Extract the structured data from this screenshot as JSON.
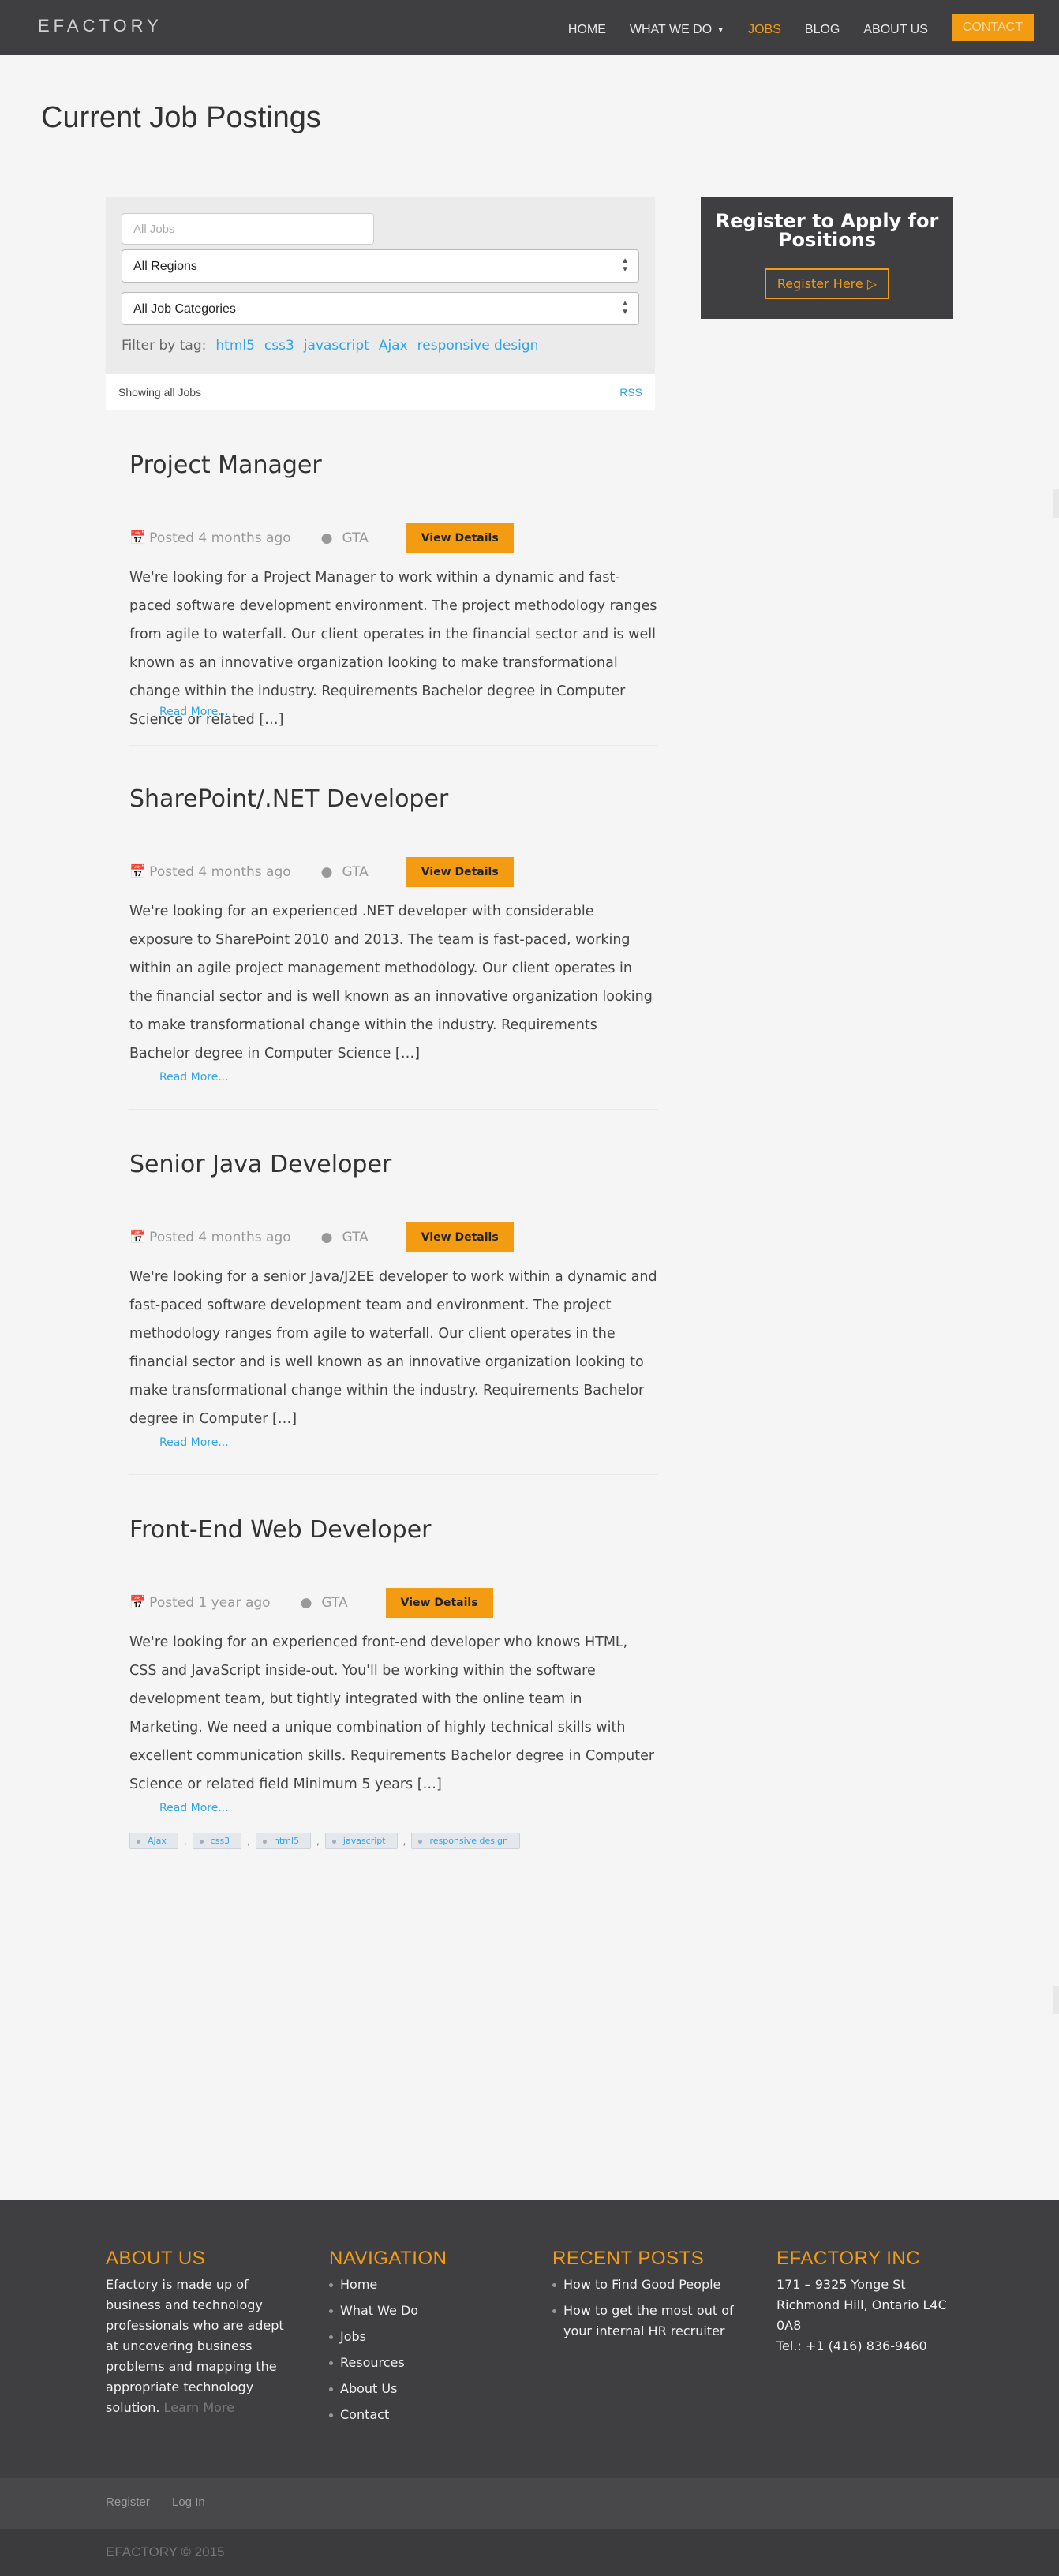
{
  "header": {
    "logo": "EFACTORY",
    "nav": [
      {
        "label": "HOME"
      },
      {
        "label": "WHAT WE DO"
      },
      {
        "label": "JOBS"
      },
      {
        "label": "BLOG"
      },
      {
        "label": "ABOUT US"
      },
      {
        "label": "CONTACT"
      }
    ]
  },
  "page_title": "Current Job Postings",
  "filters": {
    "search_placeholder": "All Jobs",
    "region": "All Regions",
    "category": "All Job Categories",
    "filter_label": "Filter by tag:",
    "tags": [
      "html5",
      "css3",
      "javascript",
      "Ajax",
      "responsive design"
    ]
  },
  "showing": {
    "text": "Showing all Jobs",
    "rss": "RSS"
  },
  "register": {
    "title": "Register to Apply for Positions",
    "button": "Register Here"
  },
  "jobs": [
    {
      "title": "Project Manager",
      "posted": "Posted 4 months ago",
      "location": "GTA",
      "button": "View Details",
      "excerpt": "We're looking for a Project Manager to work within a dynamic and fast-paced software development environment. The project methodology ranges from agile to waterfall. Our client operates in the financial sector and is well known as an innovative organization looking to make transformational change within the industry. Requirements Bachelor degree in Computer Science or related […]",
      "read_more": "Read More..."
    },
    {
      "title": "SharePoint/.NET Developer",
      "posted": "Posted 4 months ago",
      "location": "GTA",
      "button": "View Details",
      "excerpt": "We're looking for an experienced .NET developer with considerable exposure to SharePoint 2010 and 2013. The team is fast-paced, working within an agile project management methodology. Our client operates in the financial sector and is well known as an innovative organization looking to make transformational change within the industry. Requirements Bachelor degree in Computer Science […]",
      "read_more": "Read More..."
    },
    {
      "title": "Senior Java Developer",
      "posted": "Posted 4 months ago",
      "location": "GTA",
      "button": "View Details",
      "excerpt": "We're looking for a senior Java/J2EE developer to work within a dynamic and fast-paced software development team and environment. The project methodology ranges from agile to waterfall. Our client operates in the financial sector and is well known as an innovative organization looking to make transformational change within the industry. Requirements Bachelor degree in Computer […]",
      "read_more": "Read More..."
    },
    {
      "title": "Front-End Web Developer",
      "posted": "Posted 1 year ago",
      "location": "GTA",
      "button": "View Details",
      "excerpt": "We're looking for an experienced front-end developer who knows HTML, CSS and JavaScript inside-out. You'll be working within the software development team, but tightly integrated with the online team in Marketing. We need a unique combination of highly technical skills with excellent communication skills. Requirements Bachelor degree in Computer Science or related field Minimum 5 years […]",
      "read_more": "Read More...",
      "tags": [
        "Ajax",
        "css3",
        "html5",
        "javascript",
        "responsive design"
      ]
    }
  ],
  "footer": {
    "about": {
      "title": "ABOUT US",
      "text": "Efactory is made up of business and technology professionals who are adept at uncovering business problems and mapping the appropriate technology solution.",
      "learn_more": "Learn More"
    },
    "navigation": {
      "title": "NAVIGATION",
      "items": [
        "Home",
        "What We Do",
        "Jobs",
        "Resources",
        "About Us",
        "Contact"
      ]
    },
    "recent_posts": {
      "title": "RECENT POSTS",
      "items": [
        "How to Find Good People",
        "How to get the most out of your internal HR recruiter"
      ]
    },
    "company": {
      "title": "EFACTORY INC",
      "address1": "171 – 9325 Yonge St",
      "address2": "Richmond Hill, Ontario L4C 0A8",
      "phone": "Tel.: +1 (416) 836-9460"
    }
  },
  "subfooter": {
    "register": "Register",
    "login": "Log In"
  },
  "copyright": "EFACTORY © 2015",
  "colors": {
    "accent": "#f39c12",
    "dark": "#3f3e41",
    "link": "#2fa4e7"
  }
}
